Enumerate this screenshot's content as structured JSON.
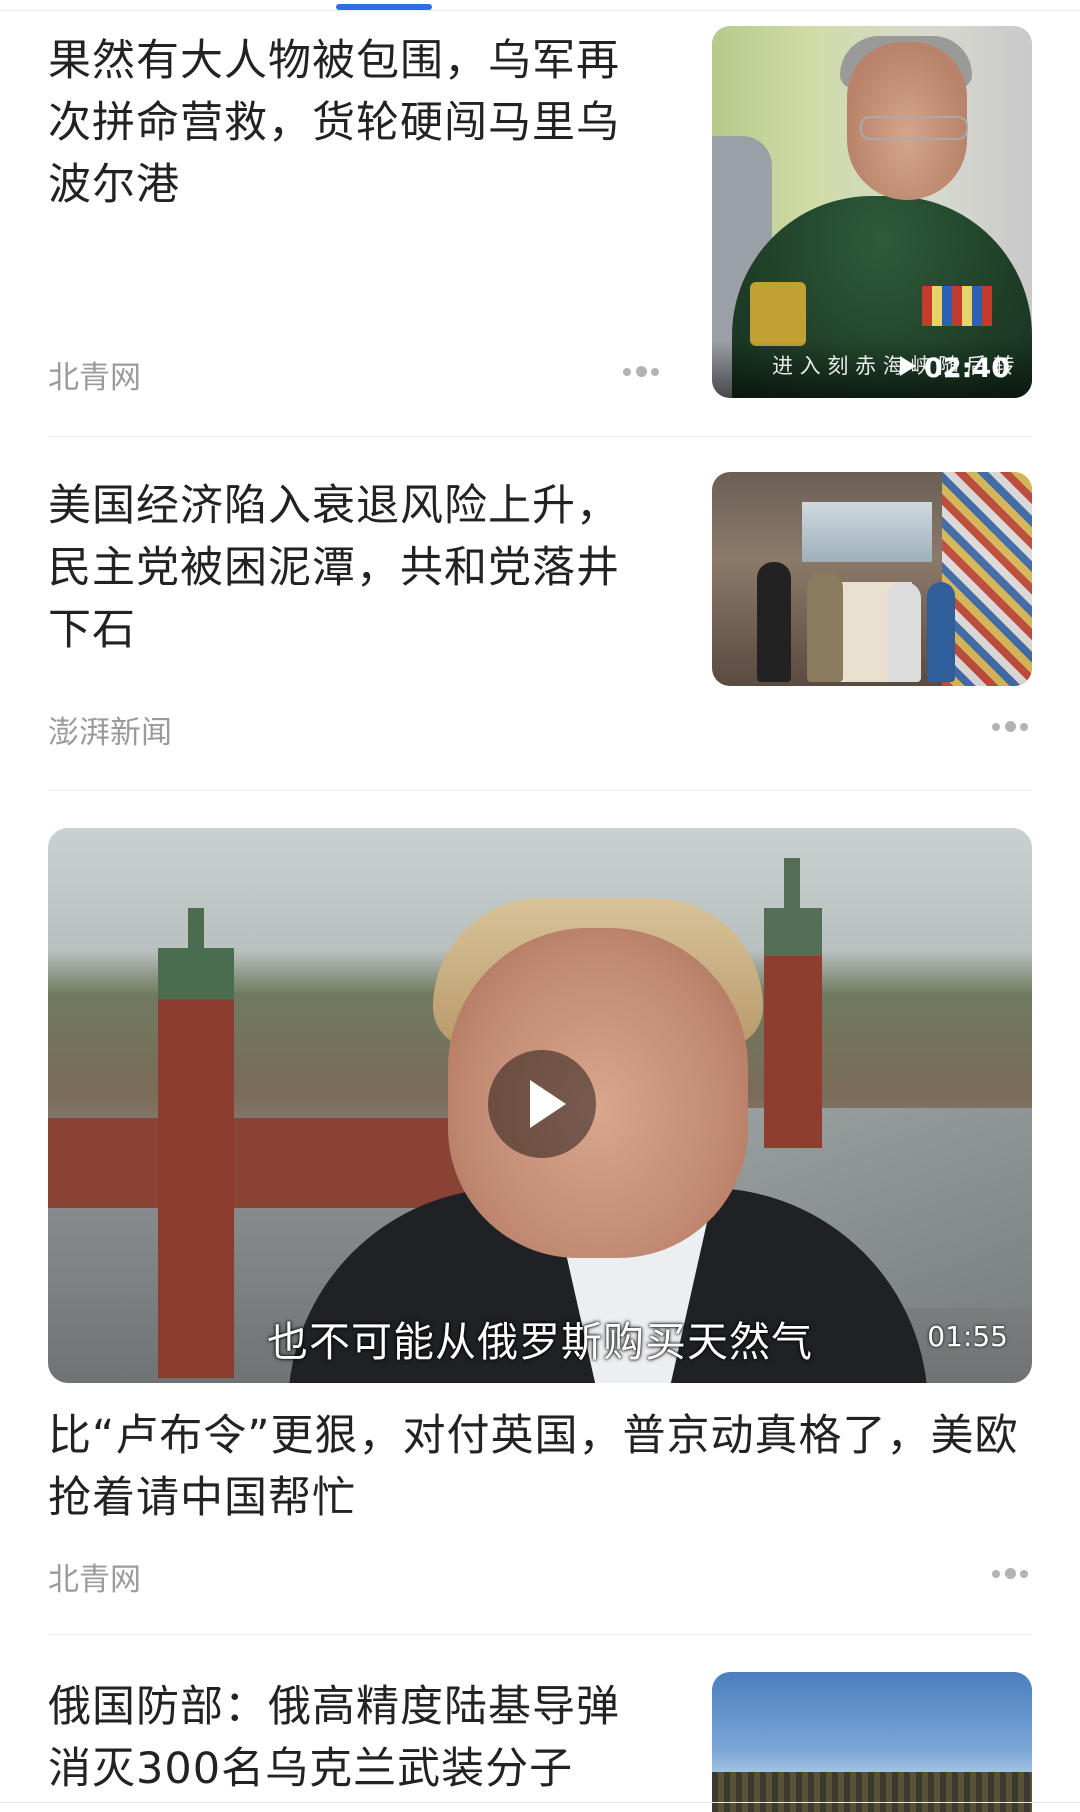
{
  "feed": {
    "articles": [
      {
        "title": "果然有大人物被包围，乌军再次拼命营救，货轮硬闯马里乌波尔港",
        "source": "北青网",
        "thumbnail": {
          "caption": "进 入 刻 赤 海 峡 随 后 转",
          "duration": "02:40"
        }
      },
      {
        "title": "美国经济陷入衰退风险上升，民主党被困泥潭，共和党落井下石",
        "source": "澎湃新闻"
      },
      {
        "title": "比“卢布令”更狠，对付英国，普京动真格了，美欧抢着请中国帮忙",
        "source": "北青网",
        "video": {
          "subtitle": "也不可能从俄罗斯购买天然气",
          "duration": "01:55"
        }
      },
      {
        "title": "俄国防部：俄高精度陆基导弹消灭300名乌克兰武装分子"
      }
    ]
  },
  "icons": {
    "more": "more-dots-icon",
    "play": "play-icon"
  },
  "colors": {
    "accent": "#2f6fe4",
    "source_text": "#9b9b9b",
    "title_text": "#222222"
  }
}
